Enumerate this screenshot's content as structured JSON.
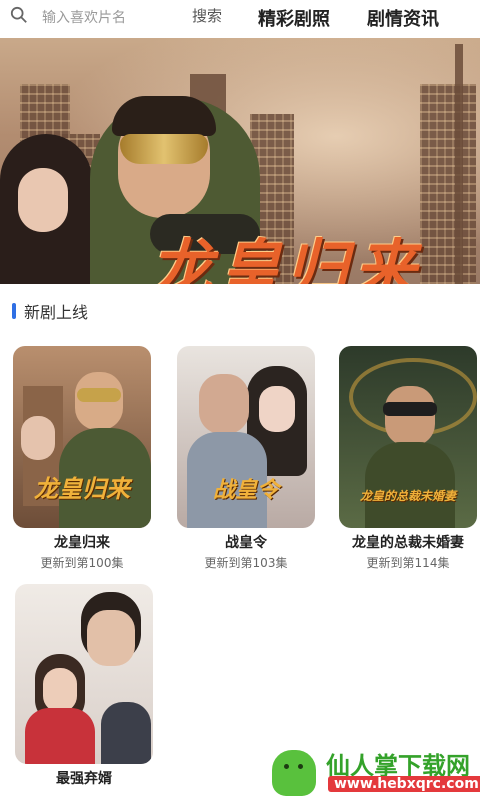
{
  "search": {
    "placeholder": "输入喜欢片名",
    "button_label": "搜索"
  },
  "tabs": [
    {
      "label": "精彩剧照"
    },
    {
      "label": "剧情资讯"
    }
  ],
  "banner": {
    "title": "龙皇归来"
  },
  "section": {
    "title": "新剧上线"
  },
  "dramas": [
    {
      "name": "龙皇归来",
      "episodes": "更新到第100集",
      "poster_text": "龙皇归来"
    },
    {
      "name": "战皇令",
      "episodes": "更新到第103集",
      "poster_text": "战皇令"
    },
    {
      "name": "龙皇的总裁未婚妻",
      "episodes": "更新到第114集",
      "poster_text": "龙皇的总裁未婚妻"
    },
    {
      "name": "最强弃婿",
      "episodes": ""
    }
  ],
  "watermark": {
    "title": "仙人掌下载网",
    "url": "www.hebxqrc.com"
  },
  "colors": {
    "accent": "#2f6fe4",
    "banner_title": "#e8622a",
    "watermark_green": "#34a22a",
    "watermark_red": "#e4393c"
  }
}
